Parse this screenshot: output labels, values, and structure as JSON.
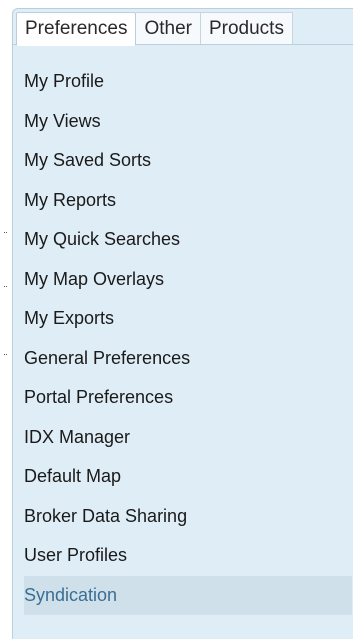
{
  "tabs": [
    {
      "label": "Preferences",
      "active": true
    },
    {
      "label": "Other",
      "active": false
    },
    {
      "label": "Products",
      "active": false
    }
  ],
  "menu": {
    "items": [
      {
        "label": "My Profile"
      },
      {
        "label": "My Views"
      },
      {
        "label": "My Saved Sorts"
      },
      {
        "label": "My Reports"
      },
      {
        "label": "My Quick Searches"
      },
      {
        "label": "My Map Overlays"
      },
      {
        "label": "My Exports"
      },
      {
        "label": "General Preferences"
      },
      {
        "label": "Portal Preferences"
      },
      {
        "label": "IDX Manager"
      },
      {
        "label": "Default Map"
      },
      {
        "label": "Broker Data Sharing"
      },
      {
        "label": "User Profiles"
      },
      {
        "label": "Syndication",
        "selected": true
      }
    ]
  },
  "colors": {
    "panel_background": "#dfedf6",
    "selected_item_background": "#cfe0ea",
    "selected_item_text": "#3a6e94"
  }
}
